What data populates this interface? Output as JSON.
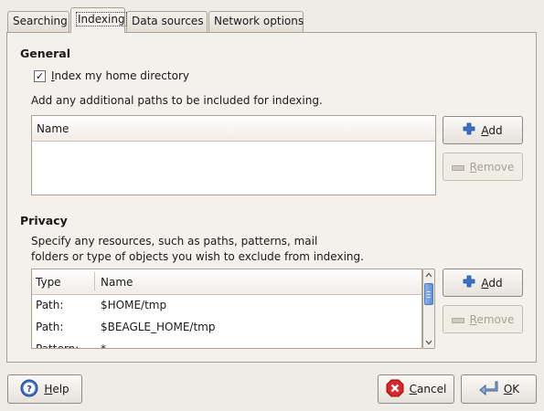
{
  "tabs": [
    {
      "label": "Searching"
    },
    {
      "label": "Indexing"
    },
    {
      "label": "Data sources"
    },
    {
      "label": "Network options"
    }
  ],
  "general": {
    "title": "General",
    "checkbox_label_prefix": "I",
    "checkbox_label_rest": "ndex my home directory",
    "checkbox_checked": true,
    "paths_text": "Add any additional paths to be included for indexing.",
    "paths_list": {
      "column": "Name",
      "rows": []
    },
    "add_button_prefix": "A",
    "add_button_rest": "dd",
    "remove_button_prefix": "R",
    "remove_button_rest": "emove"
  },
  "privacy": {
    "title": "Privacy",
    "description_line1": "Specify any resources, such as paths, patterns, mail",
    "description_line2": "folders or type of objects you wish to exclude from indexing.",
    "columns": [
      "Type",
      "Name"
    ],
    "rows": [
      {
        "type": "Path:",
        "name": "$HOME/tmp"
      },
      {
        "type": "Path:",
        "name": "$BEAGLE_HOME/tmp"
      },
      {
        "type": "Pattern:",
        "name": "*"
      }
    ],
    "add_button_prefix": "A",
    "add_button_rest": "dd",
    "remove_button_prefix": "R",
    "remove_button_rest": "emove"
  },
  "footer": {
    "help_prefix": "H",
    "help_rest": "elp",
    "cancel_prefix": "C",
    "cancel_rest": "ancel",
    "ok_prefix": "O",
    "ok_rest": "K"
  },
  "icons": {
    "add": "plus-icon",
    "remove": "minus-icon",
    "help": "help-icon",
    "cancel": "cancel-icon",
    "ok": "ok-arrow-icon"
  },
  "colors": {
    "background": "#efebe7",
    "border": "#a9a294",
    "add_icon": "#3a72c8",
    "cancel_icon": "#d8262a",
    "help_icon": "#3a6fc2"
  }
}
